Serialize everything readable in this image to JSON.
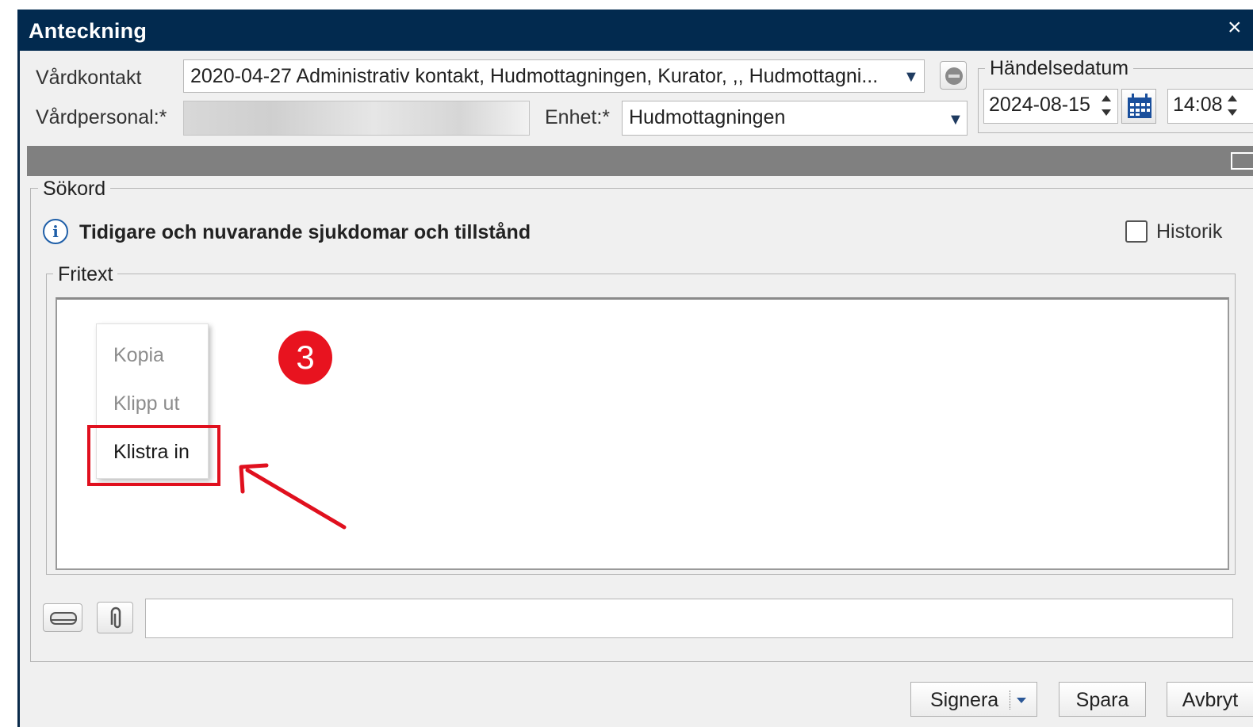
{
  "window": {
    "title": "Anteckning",
    "close_glyph": "×"
  },
  "header": {
    "vardkontakt_label": "Vårdkontakt",
    "vardkontakt_value": "2020-04-27 Administrativ kontakt, Hudmottagningen, Kurator, ,, Hudmottagni...",
    "vardpersonal_label": "Vårdpersonal:*",
    "enhet_label": "Enhet:*",
    "enhet_value": "Hudmottagningen",
    "dropdown_arrow": "▼",
    "handelsedatum_legend": "Händelsedatum",
    "date_value": "2024-08-15",
    "time_value": "14:08"
  },
  "sokord": {
    "legend": "Sökord",
    "info_glyph": "i",
    "info_text": "Tidigare och nuvarande sjukdomar och tillstånd",
    "historik_label": "Historik",
    "historik_checked": false
  },
  "fritext": {
    "legend": "Fritext",
    "context_menu": [
      {
        "label": "Kopia",
        "enabled": false
      },
      {
        "label": "Klipp ut",
        "enabled": false
      },
      {
        "label": "Klistra in",
        "enabled": true
      }
    ]
  },
  "annotation": {
    "step_number": "3",
    "color": "#e8131f"
  },
  "footer": {
    "signera_label": "Signera",
    "spara_label": "Spara",
    "avbryt_label": "Avbryt"
  },
  "colors": {
    "titlebar": "#022a4f",
    "panel": "#f0f0f0",
    "highlight": "#e0101e"
  }
}
